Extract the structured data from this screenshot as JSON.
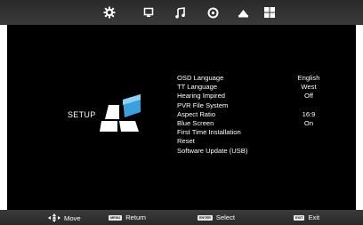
{
  "top_tabs": [
    {
      "icon": "gear-icon"
    },
    {
      "icon": "monitor-icon"
    },
    {
      "icon": "music-note-icon"
    },
    {
      "icon": "clock-icon"
    },
    {
      "icon": "lock-icon"
    },
    {
      "icon": "grid-icon"
    }
  ],
  "active_tab_index": 5,
  "page": {
    "title": "SETUP"
  },
  "menu": [
    {
      "label": "OSD Language",
      "value": "English"
    },
    {
      "label": "TT Language",
      "value": "West"
    },
    {
      "label": "Hearing Impired",
      "value": "Off"
    },
    {
      "label": "PVR File System",
      "value": ""
    },
    {
      "label": "Aspect Ratio",
      "value": "16:9"
    },
    {
      "label": "Blue Screen",
      "value": "On"
    },
    {
      "label": "First Time Installation",
      "value": ""
    },
    {
      "label": "Reset",
      "value": ""
    },
    {
      "label": "Software Update (USB)",
      "value": ""
    }
  ],
  "hints": {
    "move": "Move",
    "return_key": "MENU",
    "return": "Return",
    "select_key": "ENTER",
    "select": "Select",
    "exit_key": "EXIT",
    "exit": "Exit"
  },
  "colors": {
    "panel": "#000000",
    "bar": "#333333",
    "text": "#ffffff",
    "graphic_blue": "#3aa0e0"
  }
}
